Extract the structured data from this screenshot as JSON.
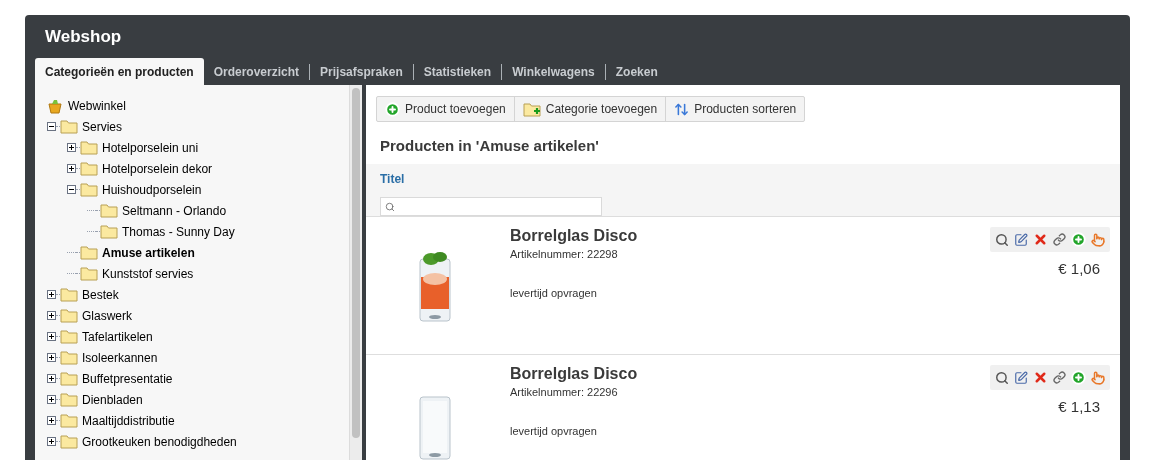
{
  "window": {
    "title": "Webshop"
  },
  "tabs": [
    {
      "label": "Categorieën en producten",
      "selected": true
    },
    {
      "label": "Orderoverzicht",
      "selected": false
    },
    {
      "label": "Prijsafspraken",
      "selected": false
    },
    {
      "label": "Statistieken",
      "selected": false
    },
    {
      "label": "Winkelwagens",
      "selected": false
    },
    {
      "label": "Zoeken",
      "selected": false
    }
  ],
  "tree": {
    "label": "Webwinkel",
    "children": [
      {
        "label": "Servies",
        "expanded": true,
        "selected": false,
        "children": [
          {
            "label": "Hotelporselein uni",
            "expanded": false,
            "selected": false
          },
          {
            "label": "Hotelporselein dekor",
            "expanded": false,
            "selected": false
          },
          {
            "label": "Huishoudporselein",
            "expanded": true,
            "selected": false,
            "children": [
              {
                "label": "Seltmann - Orlando",
                "selected": false
              },
              {
                "label": "Thomas - Sunny Day",
                "selected": false
              }
            ]
          },
          {
            "label": "Amuse artikelen",
            "selected": true
          },
          {
            "label": "Kunststof servies",
            "selected": false
          }
        ]
      },
      {
        "label": "Bestek",
        "expanded": false,
        "selected": false
      },
      {
        "label": "Glaswerk",
        "expanded": false,
        "selected": false
      },
      {
        "label": "Tafelartikelen",
        "expanded": false,
        "selected": false
      },
      {
        "label": "Isoleerkannen",
        "expanded": false,
        "selected": false
      },
      {
        "label": "Buffetpresentatie",
        "expanded": false,
        "selected": false
      },
      {
        "label": "Dienbladen",
        "expanded": false,
        "selected": false
      },
      {
        "label": "Maaltijddistributie",
        "expanded": false,
        "selected": false
      },
      {
        "label": "Grootkeuken benodigdheden",
        "expanded": false,
        "selected": false
      }
    ]
  },
  "toolbar": [
    {
      "label": "Product toevoegen",
      "kind": "add"
    },
    {
      "label": "Categorie toevoegen",
      "kind": "folder"
    },
    {
      "label": "Producten sorteren",
      "kind": "sort"
    }
  ],
  "heading": "Producten in 'Amuse artikelen'",
  "filter": {
    "column": "Titel"
  },
  "products": [
    {
      "name": "Borrelglas Disco",
      "article": "Artikelnummer: 22298",
      "delivery": "levertijd opvragen",
      "price": "€ 1,06",
      "kind": "picture"
    },
    {
      "name": "Borrelglas Disco",
      "article": "Artikelnummer: 22296",
      "delivery": "levertijd opvragen",
      "price": "€ 1,13",
      "kind": "picture"
    }
  ]
}
